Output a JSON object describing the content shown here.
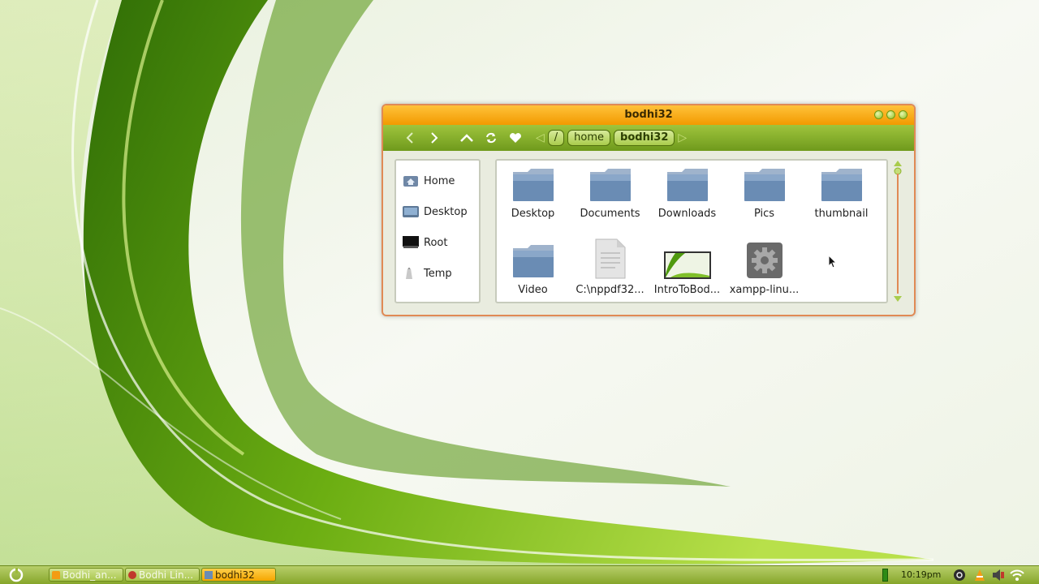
{
  "window": {
    "title": "bodhi32",
    "breadcrumbs": [
      "/",
      "home",
      "bodhi32"
    ]
  },
  "toolbar": {
    "back_icon": "chevron-left-icon",
    "forward_icon": "chevron-right-icon",
    "up_icon": "chevron-up-icon",
    "refresh_icon": "refresh-icon",
    "bookmark_icon": "heart-icon"
  },
  "sidebar": {
    "items": [
      {
        "label": "Home",
        "icon": "home-icon"
      },
      {
        "label": "Desktop",
        "icon": "desktop-icon"
      },
      {
        "label": "Root",
        "icon": "monitor-icon"
      },
      {
        "label": "Temp",
        "icon": "trash-icon"
      }
    ]
  },
  "files": [
    {
      "label": "Desktop",
      "type": "folder"
    },
    {
      "label": "Documents",
      "type": "folder"
    },
    {
      "label": "Downloads",
      "type": "folder"
    },
    {
      "label": "Pics",
      "type": "folder"
    },
    {
      "label": "thumbnail",
      "type": "folder"
    },
    {
      "label": "Video",
      "type": "folder"
    },
    {
      "label": "C:\\nppdf32...",
      "type": "document"
    },
    {
      "label": "IntroToBod...",
      "type": "image"
    },
    {
      "label": "xampp-linu...",
      "type": "executable"
    }
  ],
  "taskbar": {
    "tasks": [
      {
        "label": "Bodhi_an..."
      },
      {
        "label": "Bodhi Lin..."
      },
      {
        "label": "bodhi32"
      }
    ],
    "clock": "10:19pm"
  },
  "colors": {
    "accent_orange": "#f29a00",
    "accent_green": "#8db32e",
    "window_border": "#e08a55"
  }
}
